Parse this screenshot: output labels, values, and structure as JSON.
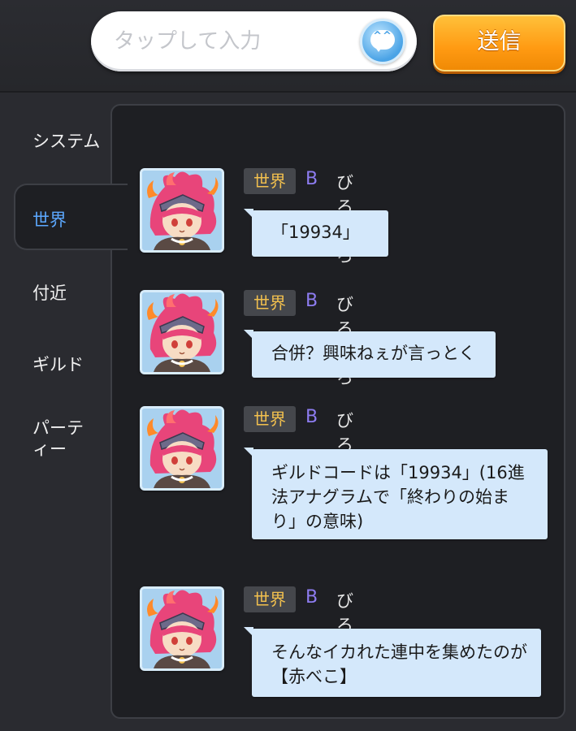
{
  "input": {
    "placeholder": "タップして入力"
  },
  "send_label": "送信",
  "tabs": [
    {
      "label": "システム"
    },
    {
      "label": "世界"
    },
    {
      "label": "付近"
    },
    {
      "label": "ギルド"
    },
    {
      "label": "パーティー"
    }
  ],
  "active_tab": "世界",
  "colors": {
    "accent": "#5ca8ff",
    "badge_text": "#f2c04e",
    "bubble": "#d4e8fb",
    "send": "#ff9a12"
  },
  "messages": [
    {
      "channel": "世界",
      "rank": "B",
      "user": "びろびろ",
      "text": "「19934」"
    },
    {
      "channel": "世界",
      "rank": "B",
      "user": "びろびろ",
      "text": "合併？興味ねぇが言っとく"
    },
    {
      "channel": "世界",
      "rank": "B",
      "user": "びろびろ",
      "text": "ギルドコードは「19934」(16進法アナグラムで「終わりの始まり」の意味)"
    },
    {
      "channel": "世界",
      "rank": "B",
      "user": "びろびろ",
      "text": "そんなイカれた連中を集めたのが【赤べこ】"
    }
  ]
}
